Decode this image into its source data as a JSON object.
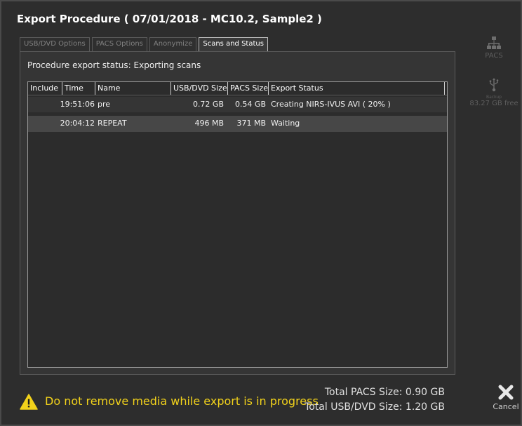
{
  "dialog": {
    "title": "Export Procedure  ( 07/01/2018 - MC10.2, Sample2 )"
  },
  "tabs": [
    {
      "label": "USB/DVD Options",
      "active": false
    },
    {
      "label": "PACS Options",
      "active": false
    },
    {
      "label": "Anonymize",
      "active": false
    },
    {
      "label": "Scans and Status",
      "active": true
    }
  ],
  "status": {
    "text": "Procedure export status: Exporting scans"
  },
  "table": {
    "columns": [
      "Include",
      "Time",
      "Name",
      "USB/DVD Size",
      "PACS Size",
      "Export Status"
    ],
    "rows": [
      {
        "include": "",
        "time": "19:51:06",
        "name": "pre",
        "usb_size": "0.72 GB",
        "pacs_size": "0.54 GB",
        "export_status": "Creating NIRS-IVUS AVI ( 20% )"
      },
      {
        "include": "",
        "time": "20:04:12",
        "name": "REPEAT",
        "usb_size": "496 MB",
        "pacs_size": "371 MB",
        "export_status": "Waiting"
      }
    ]
  },
  "destinations": {
    "pacs": {
      "label": "PACS",
      "icon": "network-icon"
    },
    "usb": {
      "label": "83.27 GB free",
      "sublabel": "Backup",
      "icon": "usb-icon"
    }
  },
  "footer": {
    "warning": "Do not remove media while export is in progress",
    "total_pacs": "Total PACS Size: 0.90 GB",
    "total_usb": "Total USB/DVD Size: 1.20 GB",
    "cancel_label": "Cancel"
  },
  "colors": {
    "background": "#2d2d2d",
    "warning": "#f2d21b",
    "selected_row": "#474747"
  }
}
